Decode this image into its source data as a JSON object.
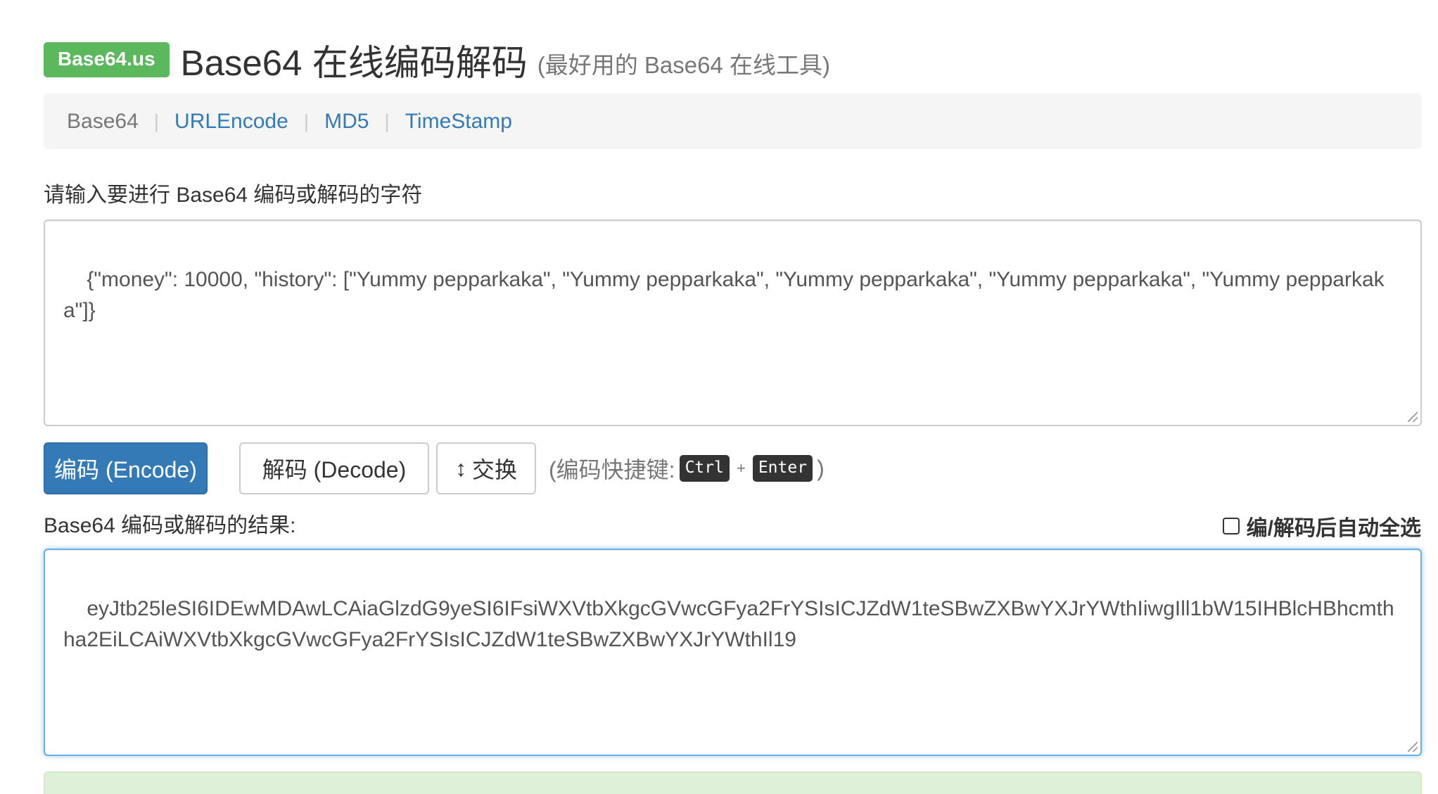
{
  "header": {
    "brand": "Base64.us",
    "title": "Base64 在线编码解码",
    "subtitle": "(最好用的 Base64 在线工具)"
  },
  "nav": {
    "items": [
      {
        "label": "Base64",
        "active": true
      },
      {
        "label": "URLEncode",
        "active": false
      },
      {
        "label": "MD5",
        "active": false
      },
      {
        "label": "TimeStamp",
        "active": false
      }
    ],
    "separator": "|"
  },
  "input": {
    "label": "请输入要进行 Base64 编码或解码的字符",
    "value": "{\"money\": 10000, \"history\": [\"Yummy pepparkaka\", \"Yummy pepparkaka\", \"Yummy pepparkaka\", \"Yummy pepparkaka\", \"Yummy pepparkaka\"]}"
  },
  "actions": {
    "encode_label": "编码 (Encode)",
    "decode_label": "解码 (Decode)",
    "swap_label": "交换",
    "swap_icon": "↕",
    "shortcut_prefix": "(编码快捷键:",
    "shortcut_key1": "Ctrl",
    "shortcut_plus": "+",
    "shortcut_key2": "Enter",
    "shortcut_suffix": ")"
  },
  "output": {
    "label": "Base64 编码或解码的结果:",
    "auto_select_label": "编/解码后自动全选",
    "auto_select_checked": false,
    "value": "eyJtb25leSI6IDEwMDAwLCAiaGlzdG9yeSI6IFsiWXVtbXkgcGVwcGFya2FrYSIsICJZdW1teSBwZXBwYXJrYWthIiwgIll1bW15IHBlcHBhcmthha2EiLCAiWXVtbXkgcGVwcGFya2FrYSIsICJZdW1teSBwZXBwYXJrYWthIl19"
  },
  "colors": {
    "brand_green": "#5cb85c",
    "primary_blue": "#337ab7",
    "link_blue": "#337ab7",
    "focus_blue": "#66afe9",
    "success_bg": "#dff0d8"
  }
}
